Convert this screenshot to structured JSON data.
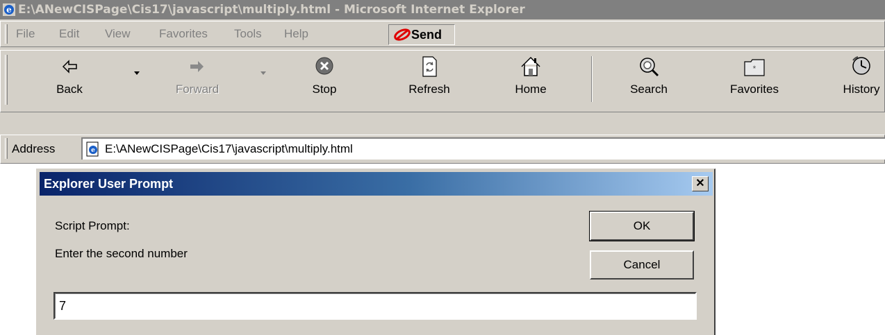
{
  "window": {
    "title": "E:\\ANewCISPage\\Cis17\\javascript\\multiply.html - Microsoft Internet Explorer"
  },
  "menu": {
    "items": [
      "File",
      "Edit",
      "View",
      "Favorites",
      "Tools",
      "Help"
    ],
    "send_label": "Send"
  },
  "toolbar": {
    "buttons": [
      {
        "label": "Back",
        "icon": "back-arrow-icon",
        "enabled": true
      },
      {
        "label": "Forward",
        "icon": "forward-arrow-icon",
        "enabled": false
      },
      {
        "label": "Stop",
        "icon": "stop-icon",
        "enabled": true
      },
      {
        "label": "Refresh",
        "icon": "refresh-icon",
        "enabled": true
      },
      {
        "label": "Home",
        "icon": "home-icon",
        "enabled": true
      },
      {
        "label": "Search",
        "icon": "search-icon",
        "enabled": true
      },
      {
        "label": "Favorites",
        "icon": "favorites-icon",
        "enabled": true
      },
      {
        "label": "History",
        "icon": "history-icon",
        "enabled": true
      }
    ]
  },
  "address": {
    "label": "Address",
    "value": "E:\\ANewCISPage\\Cis17\\javascript\\multiply.html"
  },
  "dialog": {
    "title": "Explorer User Prompt",
    "close_glyph": "✕",
    "heading": "Script Prompt:",
    "message": "Enter the second number",
    "ok_label": "OK",
    "cancel_label": "Cancel",
    "input_value": "7"
  },
  "colors": {
    "chrome": "#d4d0c8",
    "title_bar_inactive": "#808080",
    "dialog_title_start": "#0a246a",
    "dialog_title_end": "#a6caf0"
  }
}
